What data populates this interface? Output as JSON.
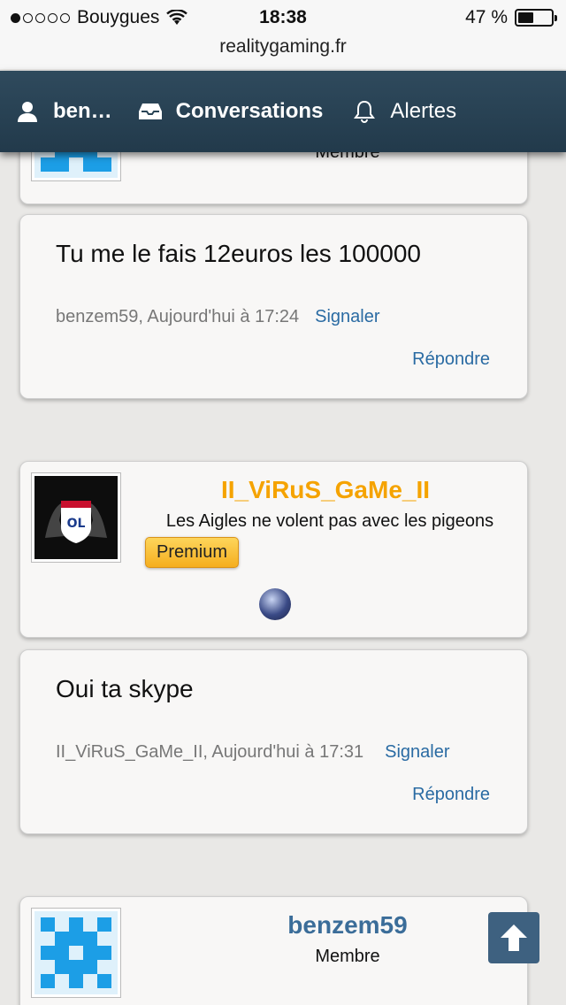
{
  "status": {
    "carrier": "Bouygues",
    "time": "18:38",
    "battery": "47 %",
    "battery_level": 0.47
  },
  "browser": {
    "url": "realitygaming.fr"
  },
  "nav": {
    "user": "ben…",
    "conversations": "Conversations",
    "alerts": "Alertes"
  },
  "posts": [
    {
      "user_title": "Membre"
    },
    {
      "text": "Tu me le fais 12euros les 100000",
      "author_time": "benzem59, Aujourd'hui à 17:24",
      "report": "Signaler",
      "reply": "Répondre"
    },
    {
      "username": "II_ViRuS_GaMe_II",
      "user_title": "Les Aigles ne volent pas avec les pigeons",
      "badge": "Premium"
    },
    {
      "text": "Oui ta skype",
      "author_time": "II_ViRuS_GaMe_II, Aujourd'hui à 17:31",
      "report": "Signaler",
      "reply": "Répondre"
    },
    {
      "username": "benzem59",
      "user_title": "Membre"
    }
  ],
  "colors": {
    "nav": "#2a4456",
    "link": "#2a6ba3",
    "username_premium": "#f5a300",
    "username_member": "#3b6d99"
  }
}
